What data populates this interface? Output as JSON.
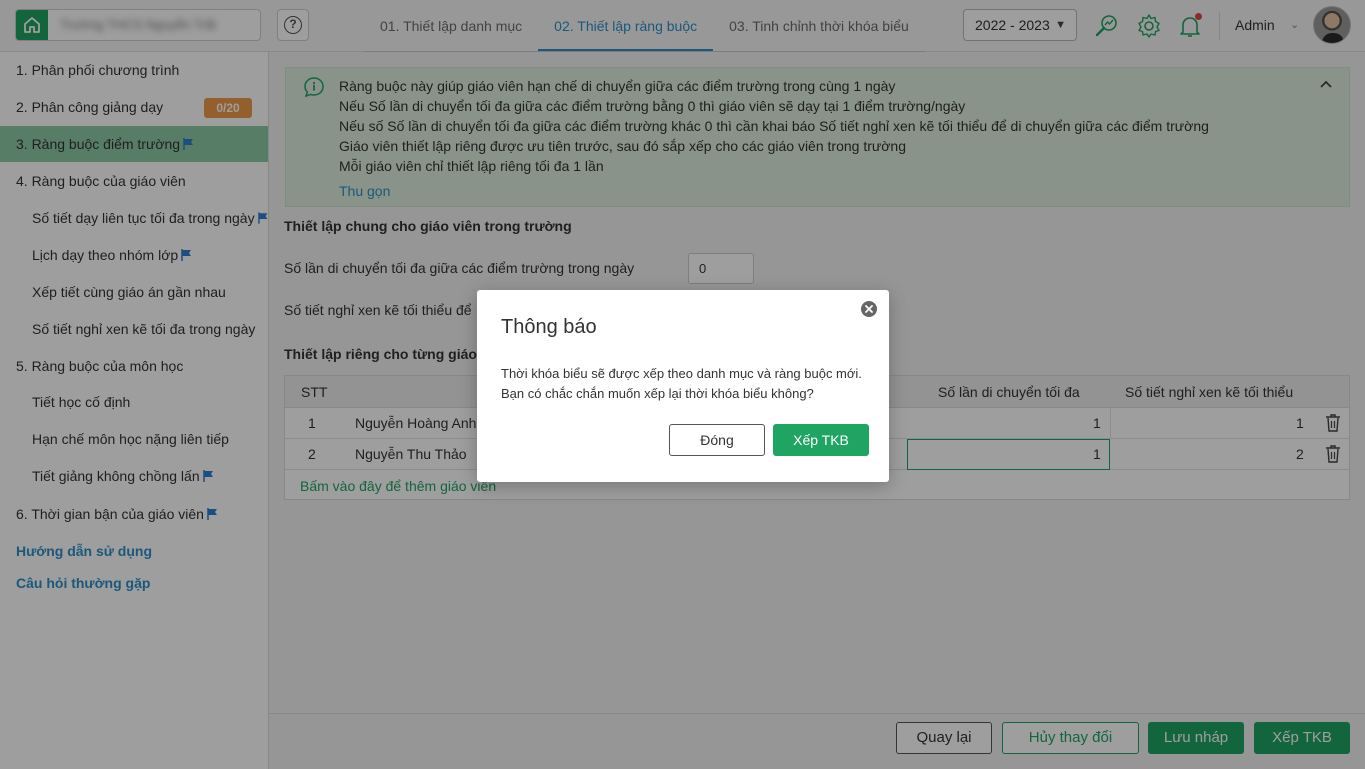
{
  "header": {
    "school_name": "Trường THCS Nguyễn Trãi",
    "steps": [
      "01. Thiết lập danh mục",
      "02. Thiết lập ràng buộc",
      "03. Tinh chỉnh thời khóa biểu"
    ],
    "active_step": 1,
    "year": "2022 - 2023",
    "user": "Admin",
    "accent_color": "#1fa463",
    "link_color": "#2e8fc9"
  },
  "sidebar": {
    "items": [
      {
        "label": "1. Phân phối chương trình"
      },
      {
        "label": "2. Phân công giảng dạy",
        "badge": "0/20"
      },
      {
        "label": "3. Ràng buộc điểm trường"
      },
      {
        "label": "4. Ràng buộc của giáo viên"
      },
      {
        "label": "Số tiết dạy liên tục tối đa trong ngày"
      },
      {
        "label": "Lịch dạy theo nhóm lớp"
      },
      {
        "label": "Xếp tiết cùng giáo án gần nhau"
      },
      {
        "label": "Số tiết nghỉ xen kẽ tối đa trong ngày"
      },
      {
        "label": "5. Ràng buộc của môn học"
      },
      {
        "label": "Tiết học cố định"
      },
      {
        "label": "Hạn chế môn học nặng liên tiếp"
      },
      {
        "label": "Tiết giảng không chồng lấn"
      },
      {
        "label": "6. Thời gian bận của giáo viên"
      }
    ],
    "links": [
      "Hướng dẫn sử dụng",
      "Câu hỏi thường gặp"
    ]
  },
  "notice": {
    "lines": [
      "Ràng buộc này giúp giáo viên hạn chế di chuyển giữa các điểm trường trong cùng 1 ngày",
      "Nếu Số lần di chuyển tối đa giữa các điểm trường bằng 0 thì giáo viên sẽ dạy tại 1 điểm trường/ngày",
      "Nếu số Số lần di chuyển tối đa giữa các điểm trường khác 0 thì cần khai báo Số tiết nghỉ xen kẽ tối thiểu để di chuyển giữa các điểm trường",
      "Giáo viên thiết lập riêng được ưu tiên trước, sau đó sắp xếp cho các giáo viên trong trường",
      "Mỗi giáo viên chỉ thiết lập riêng tối đa 1 lần"
    ],
    "collapse_label": "Thu gọn"
  },
  "general": {
    "title": "Thiết lập chung cho giáo viên trong trường",
    "max_moves_label": "Số lần di chuyển tối đa giữa các điểm trường trong ngày",
    "max_moves_value": "0",
    "min_break_label": "Số tiết nghỉ xen kẽ tối thiểu để"
  },
  "individual": {
    "title": "Thiết lập riêng cho từng giáo v",
    "columns": [
      "STT",
      "Số lần di chuyển tối đa",
      "Số tiết nghỉ xen kẽ tối thiểu"
    ],
    "rows": [
      {
        "stt": "1",
        "name": "Nguyễn Hoàng Anh",
        "moves": "1",
        "breaks": "1"
      },
      {
        "stt": "2",
        "name": "Nguyễn Thu Thảo",
        "moves": "1",
        "breaks": "2"
      }
    ],
    "add_link": "Bấm vào đây để thêm giáo viên"
  },
  "footer": {
    "back": "Quay lại",
    "discard": "Hủy thay đổi",
    "save_draft": "Lưu nháp",
    "schedule": "Xếp TKB"
  },
  "modal": {
    "title": "Thông báo",
    "message": "Thời khóa biểu sẽ được xếp theo danh mục và ràng buộc mới. Bạn có chắc chắn muốn xếp lại thời khóa biểu không?",
    "cancel": "Đóng",
    "confirm": "Xếp TKB"
  }
}
